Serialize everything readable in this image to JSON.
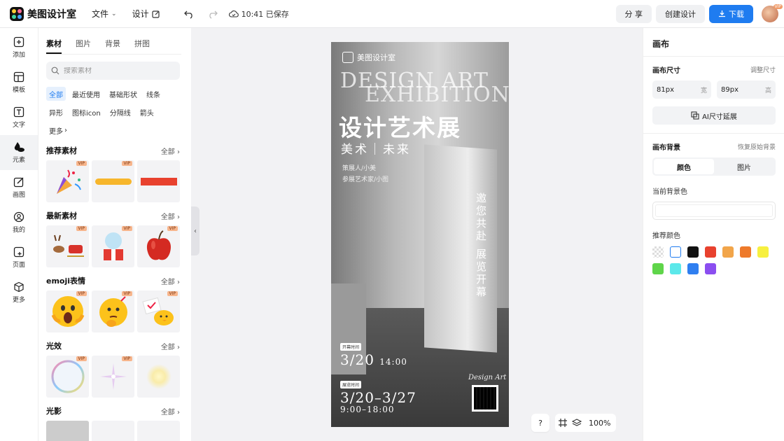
{
  "app": {
    "name": "美图设计室"
  },
  "topbar": {
    "file_label": "文件",
    "design_label": "设计",
    "saved_text": "10:41 已保存",
    "share_label": "分 享",
    "create_label": "创建设计",
    "download_label": "下载",
    "vip_badge": "VIP"
  },
  "rail": {
    "items": [
      {
        "label": "添加",
        "icon": "plus-square-icon"
      },
      {
        "label": "模板",
        "icon": "template-icon"
      },
      {
        "label": "文字",
        "icon": "text-icon"
      },
      {
        "label": "元素",
        "icon": "shapes-icon"
      },
      {
        "label": "画图",
        "icon": "pencil-icon"
      },
      {
        "label": "我的",
        "icon": "user-icon"
      },
      {
        "label": "页面",
        "icon": "page-icon"
      },
      {
        "label": "更多",
        "icon": "cube-icon"
      }
    ],
    "active_index": 3
  },
  "panel": {
    "tabs": [
      "素材",
      "图片",
      "背景",
      "拼图"
    ],
    "active_tab": 0,
    "search_placeholder": "搜索素材",
    "chips": [
      "全部",
      "最近使用",
      "基础形状",
      "线条",
      "异形",
      "图标icon",
      "分隔线",
      "箭头",
      "更多"
    ],
    "all_label": "全部",
    "vip_label": "VIP",
    "sections": [
      {
        "title": "推荐素材"
      },
      {
        "title": "最新素材"
      },
      {
        "title": "emoji表情"
      },
      {
        "title": "光效"
      },
      {
        "title": "光影"
      }
    ]
  },
  "poster": {
    "brand": "美图设计室",
    "design_line1": "DESIGN ART",
    "design_line2": "EXHIBITION",
    "title": "设计艺术展",
    "subtitle": "美术｜未来",
    "name1": "策展人/小美",
    "name2": "参展艺术家/小图",
    "vertical_text": "邀您共赴 展览开幕",
    "tag1": "开幕时间",
    "date1": "3/20",
    "time1": "14:00",
    "tag2": "展览时间",
    "date2": "3/20–3/27",
    "time2": "9:00–18:00",
    "signature": "Design Art"
  },
  "canvas_tools": {
    "help": "?",
    "zoom": "100%"
  },
  "right": {
    "title": "画布",
    "size_label": "画布尺寸",
    "adjust_size": "调整尺寸",
    "width_value": "81px",
    "width_unit": "宽",
    "height_value": "89px",
    "height_unit": "高",
    "ai_extend": "AI尺寸延展",
    "bg_label": "画布背景",
    "restore_bg": "恢复原始背景",
    "seg_color": "颜色",
    "seg_image": "图片",
    "current_bg": "当前背景色",
    "recommend": "推荐颜色",
    "colors": [
      "transparent",
      "#ffffff",
      "#111111",
      "#e8412e",
      "#f2a54a",
      "#ee7a2b",
      "#f7f03f",
      "#5fd54a",
      "#5ce8ea",
      "#2f7ff0",
      "#8b4ef0"
    ]
  },
  "accent": "#1f7cf0"
}
